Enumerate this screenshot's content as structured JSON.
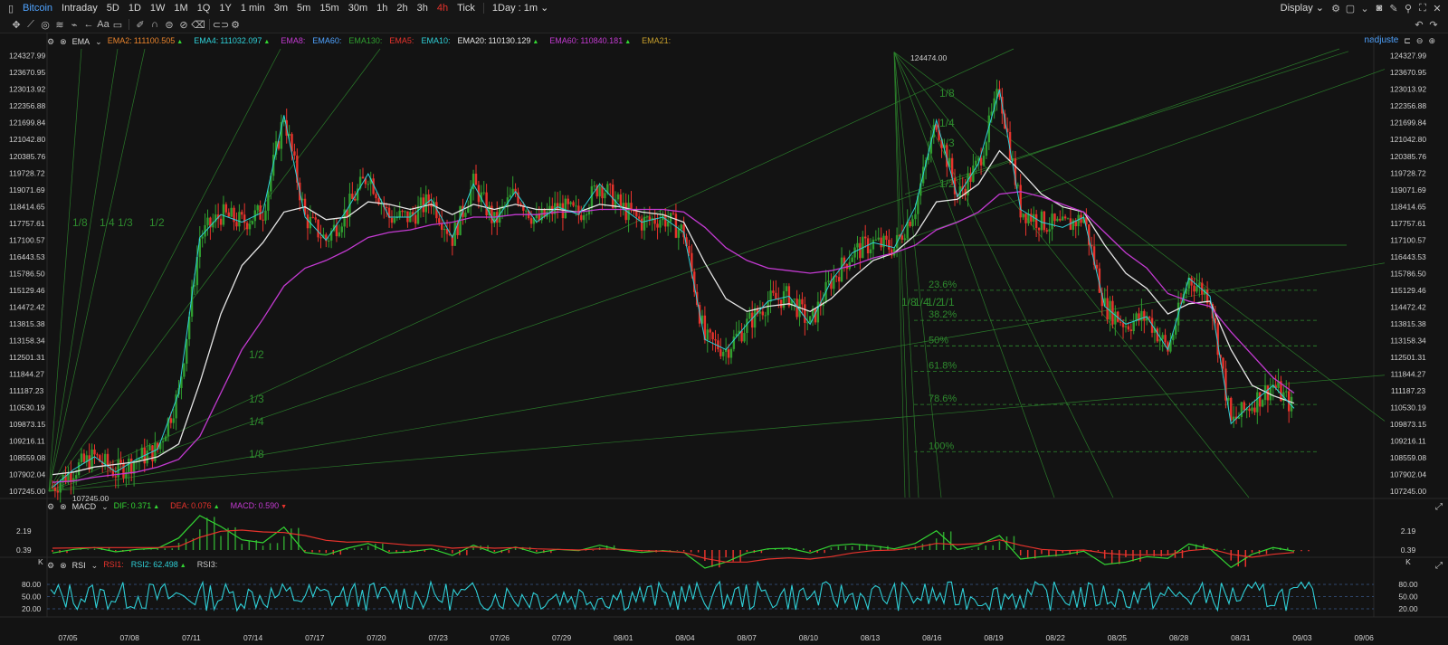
{
  "header": {
    "symbol": "Bitcoin",
    "timeframes": [
      "Intraday",
      "5D",
      "1D",
      "1W",
      "1M",
      "1Q",
      "1Y",
      "1 min",
      "3m",
      "5m",
      "15m",
      "30m",
      "1h",
      "2h",
      "3h",
      "4h",
      "Tick"
    ],
    "active_timeframe": "4h",
    "interval_select": "1Day : 1m",
    "display_label": "Display"
  },
  "toolbar": {
    "icons": [
      "crosshair-icon",
      "draw-line-icon",
      "shapes-icon",
      "fib-icon",
      "pattern-icon",
      "arrow-icon",
      "text-icon",
      "comment-icon",
      "pen-icon",
      "magnet-icon",
      "lock-icon",
      "eye-off-icon",
      "trash-icon",
      "link-icon",
      "settings-icon"
    ],
    "adjust_label": "nadjuste"
  },
  "colors": {
    "bg": "#131313",
    "up": "#2f9e2f",
    "down": "#e8332c",
    "ema_white": "#e6e6e6",
    "ema_cyan": "#2fd0d8",
    "ema_magenta": "#c33ad1",
    "fib": "#2e8b2e",
    "rsi": "#2fd0d8"
  },
  "main_legend": {
    "indicator": "EMA",
    "items": [
      {
        "name": "EMA2:",
        "value": "111100.505",
        "color": "#e8832c",
        "arrow": "▲"
      },
      {
        "name": "EMA4:",
        "value": "111032.097",
        "color": "#2fd0d8",
        "arrow": "▲"
      },
      {
        "name": "EMA8:",
        "value": "",
        "color": "#c33ad1",
        "arrow": ""
      },
      {
        "name": "EMA60:",
        "value": "",
        "color": "#4fa3ff",
        "arrow": ""
      },
      {
        "name": "EMA130:",
        "value": "",
        "color": "#2f9e2f",
        "arrow": ""
      },
      {
        "name": "EMA5:",
        "value": "",
        "color": "#e8332c",
        "arrow": ""
      },
      {
        "name": "EMA10:",
        "value": "",
        "color": "#2fd0d8",
        "arrow": ""
      },
      {
        "name": "EMA20:",
        "value": "110130.129",
        "color": "#e6e6e6",
        "arrow": "▲"
      },
      {
        "name": "EMA60:",
        "value": "110840.181",
        "color": "#c33ad1",
        "arrow": "▲"
      },
      {
        "name": "EMA21:",
        "value": "",
        "color": "#c8a02c",
        "arrow": ""
      }
    ]
  },
  "macd_legend": {
    "indicator": "MACD",
    "items": [
      {
        "name": "DIF:",
        "value": "0.371",
        "color": "#33d633",
        "arrow": "▲"
      },
      {
        "name": "DEA:",
        "value": "0.076",
        "color": "#e8332c",
        "arrow": "▲"
      },
      {
        "name": "MACD:",
        "value": "0.590",
        "color": "#c33ad1",
        "arrow": "▼"
      }
    ]
  },
  "rsi_legend": {
    "indicator": "RSI",
    "items": [
      {
        "name": "RSI1:",
        "value": "",
        "color": "#e8332c",
        "arrow": ""
      },
      {
        "name": "RSI2:",
        "value": "62.498",
        "color": "#2fd0d8",
        "arrow": "▲"
      },
      {
        "name": "RSI3:",
        "value": "",
        "color": "#c8c8c8",
        "arrow": ""
      }
    ]
  },
  "chart_data": [
    {
      "type": "line",
      "title": "",
      "price_ticks": [
        "124327.99",
        "123670.95",
        "123013.92",
        "122356.88",
        "121699.84",
        "121042.80",
        "120385.76",
        "119728.72",
        "119071.69",
        "118414.65",
        "117757.61",
        "117100.57",
        "116443.53",
        "115786.50",
        "115129.46",
        "114472.42",
        "113815.38",
        "113158.34",
        "112501.31",
        "111844.27",
        "111187.23",
        "110530.19",
        "109873.15",
        "109216.11",
        "108559.08",
        "107902.04",
        "107245.00"
      ],
      "x_ticks": [
        "07/05",
        "07/08",
        "07/11",
        "07/14",
        "07/17",
        "07/20",
        "07/23",
        "07/26",
        "07/29",
        "08/01",
        "08/04",
        "08/07",
        "08/10",
        "08/13",
        "08/16",
        "08/19",
        "08/22",
        "08/25",
        "08/28",
        "08/31",
        "09/03",
        "09/06"
      ],
      "ylim": [
        107000,
        124600
      ],
      "annotations": {
        "high": "124474.00",
        "low": "107245.00"
      },
      "fib_retracement_labels": [
        "23.6%",
        "38.2%",
        "50%",
        "61.8%",
        "78.6%",
        "100%"
      ],
      "fib_levels": [
        115129,
        113950,
        112950,
        111950,
        110650,
        108800
      ],
      "fan_labels_left": [
        "1/8",
        "1/4",
        "1/3",
        "1/2"
      ],
      "fan_labels_mid": [
        "1/2",
        "1/3",
        "1/4",
        "1/8"
      ],
      "fan_labels_top": [
        "1/8",
        "1/4",
        "1/3",
        "1/2"
      ],
      "fan_labels_cluster": [
        "1/8",
        "1/4",
        "1/2",
        "1/1"
      ],
      "series": [
        {
          "name": "Price",
          "color": "#d9d9d9",
          "x": [
            0,
            1,
            2,
            3,
            4,
            5,
            6,
            7,
            8,
            9,
            10,
            11,
            12,
            13,
            14,
            15,
            16,
            17,
            18,
            19,
            20,
            21,
            22,
            23,
            24,
            25,
            26,
            27,
            28,
            29,
            30,
            31,
            32,
            33,
            34,
            35,
            36,
            37,
            38,
            39,
            40,
            41,
            42,
            43,
            44,
            45,
            46,
            47,
            48,
            49,
            50,
            51,
            52,
            53,
            54,
            55,
            56,
            57,
            58,
            59
          ],
          "values": [
            107400,
            108100,
            108600,
            108000,
            108500,
            108900,
            111100,
            117200,
            118100,
            117800,
            118200,
            122000,
            118000,
            117100,
            118300,
            119700,
            118000,
            118000,
            118700,
            117200,
            119300,
            117800,
            119000,
            117800,
            118400,
            118100,
            119300,
            118400,
            117800,
            118000,
            117400,
            113200,
            112800,
            113800,
            114700,
            114900,
            113800,
            115500,
            116600,
            117000,
            116800,
            118400,
            121800,
            118800,
            120100,
            123000,
            118300,
            117800,
            117600,
            118000,
            114500,
            113800,
            114100,
            112800,
            115600,
            114900,
            109900,
            110700,
            111400,
            110500
          ]
        },
        {
          "name": "EMA20",
          "color": "#e6e6e6",
          "values": [
            107900,
            108000,
            108200,
            108300,
            108400,
            108600,
            109100,
            111500,
            114200,
            116100,
            117000,
            118200,
            118400,
            117900,
            118000,
            118600,
            118500,
            118300,
            118500,
            118100,
            118500,
            118300,
            118500,
            118300,
            118300,
            118200,
            118500,
            118400,
            118200,
            118100,
            117800,
            116200,
            114800,
            114300,
            114500,
            114600,
            114300,
            114800,
            115600,
            116300,
            116600,
            117300,
            118600,
            118700,
            119300,
            120600,
            119800,
            118900,
            118400,
            118200,
            116900,
            115800,
            115200,
            114200,
            114600,
            114700,
            112800,
            111400,
            111000,
            110700
          ]
        },
        {
          "name": "EMA60",
          "color": "#c33ad1",
          "values": [
            107600,
            107650,
            107800,
            107900,
            108000,
            108200,
            108500,
            109400,
            111100,
            112800,
            114000,
            115300,
            116000,
            116300,
            116700,
            117200,
            117400,
            117500,
            117700,
            117800,
            118000,
            118000,
            118100,
            118100,
            118200,
            118200,
            118300,
            118300,
            118300,
            118300,
            118200,
            117600,
            116800,
            116300,
            116000,
            115900,
            115800,
            115900,
            116100,
            116400,
            116600,
            116900,
            117500,
            117800,
            118200,
            118900,
            119000,
            118800,
            118500,
            118200,
            117400,
            116600,
            116000,
            115000,
            114700,
            114500,
            113500,
            112600,
            111700,
            111100
          ]
        }
      ]
    },
    {
      "type": "bar",
      "title": "MACD",
      "y_ticks": [
        "2.19",
        "0.39"
      ],
      "series": [
        {
          "name": "DIF",
          "color": "#33d633"
        },
        {
          "name": "DEA",
          "color": "#e8332c"
        },
        {
          "name": "MACD",
          "color": "#c33ad1"
        }
      ]
    },
    {
      "type": "line",
      "title": "RSI",
      "y_ticks": [
        "80.00",
        "50.00",
        "20.00"
      ],
      "ylim": [
        0,
        100
      ]
    }
  ]
}
